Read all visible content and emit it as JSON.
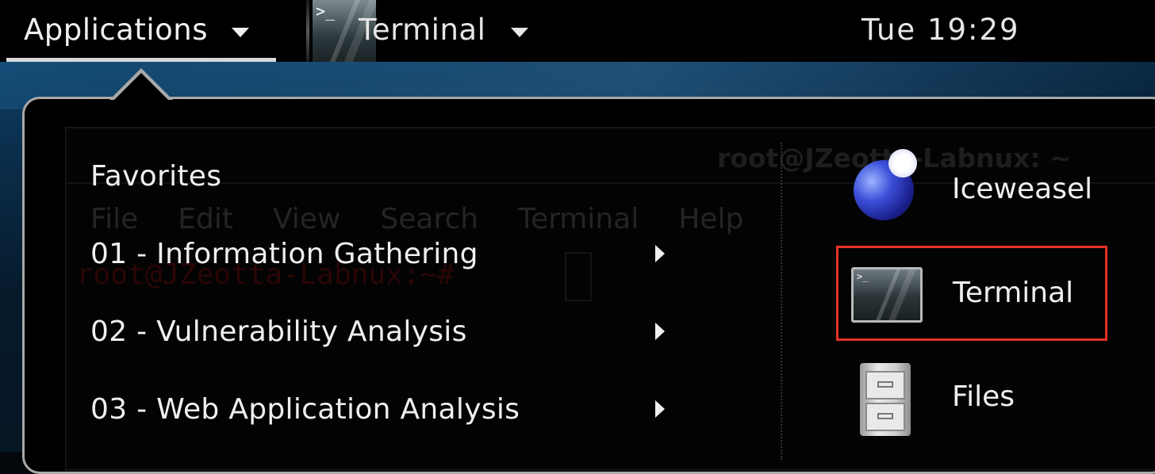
{
  "top_bar": {
    "applications_label": "Applications",
    "active_app_label": "Terminal",
    "clock": "Tue 19:29"
  },
  "background_terminal": {
    "title": "root@JZeotta-Labnux: ~",
    "menu": [
      "File",
      "Edit",
      "View",
      "Search",
      "Terminal",
      "Help"
    ],
    "prompt": "root@JZeotta-Labnux:~#"
  },
  "menu": {
    "categories": [
      {
        "label": "Favorites",
        "has_submenu": false
      },
      {
        "label": "01 - Information Gathering",
        "has_submenu": true
      },
      {
        "label": "02 - Vulnerability Analysis",
        "has_submenu": true
      },
      {
        "label": "03 - Web Application Analysis",
        "has_submenu": true
      }
    ],
    "apps": [
      {
        "label": "Iceweasel",
        "icon": "iceweasel-icon"
      },
      {
        "label": "Terminal",
        "icon": "terminal-icon",
        "highlighted": true,
        "highlight_color": "#e53227"
      },
      {
        "label": "Files",
        "icon": "file-cabinet-icon"
      }
    ]
  }
}
